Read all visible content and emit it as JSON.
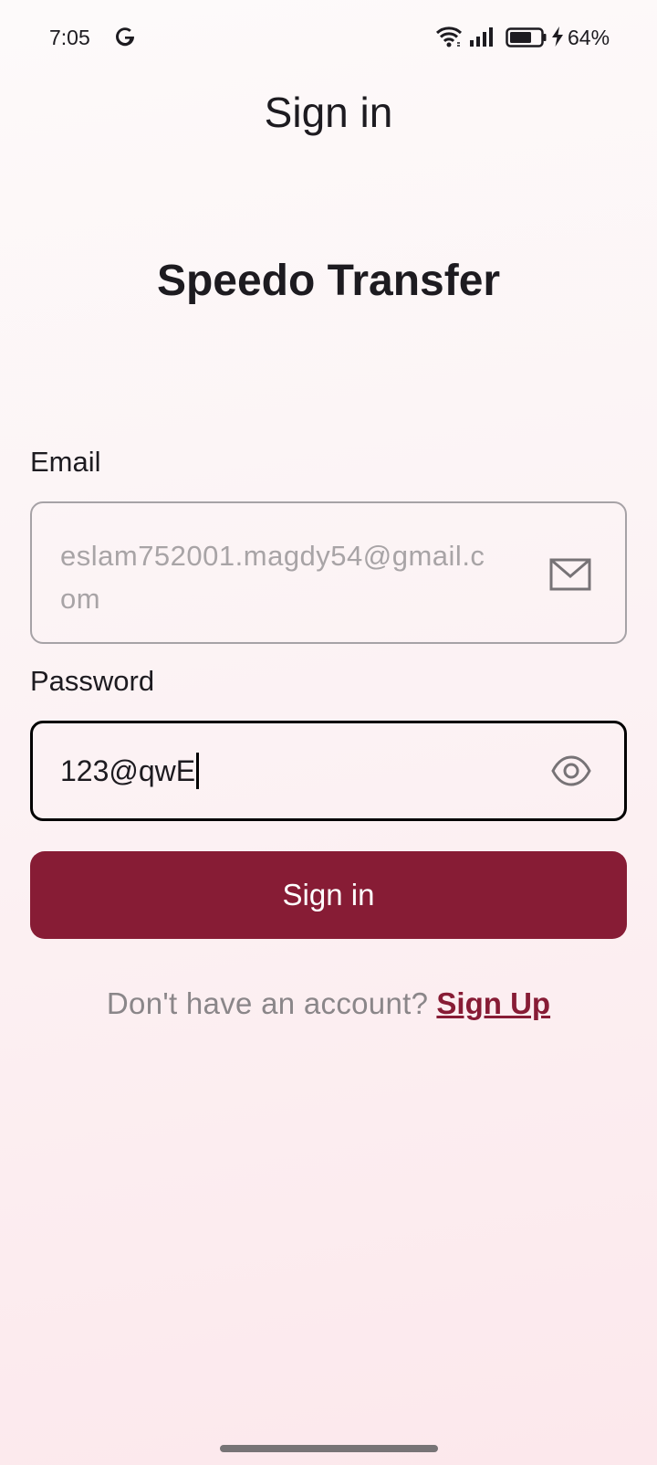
{
  "status_bar": {
    "time": "7:05",
    "battery_percent": "64%",
    "icons": [
      "google-icon",
      "wifi-icon",
      "signal-icon",
      "battery-icon",
      "charging-icon"
    ]
  },
  "header": {
    "title": "Sign in"
  },
  "brand": {
    "name": "Speedo Transfer"
  },
  "form": {
    "email": {
      "label": "Email",
      "value": "eslam752001.magdy54@gmail.com",
      "icon": "mail-icon"
    },
    "password": {
      "label": "Password",
      "value": "123@qwE",
      "icon": "eye-icon"
    },
    "submit_label": "Sign in"
  },
  "footer": {
    "prompt": "Don't have an account?",
    "link_label": "Sign Up"
  },
  "colors": {
    "primary": "#871c35",
    "text": "#1d1b20",
    "muted": "#8a8689"
  }
}
